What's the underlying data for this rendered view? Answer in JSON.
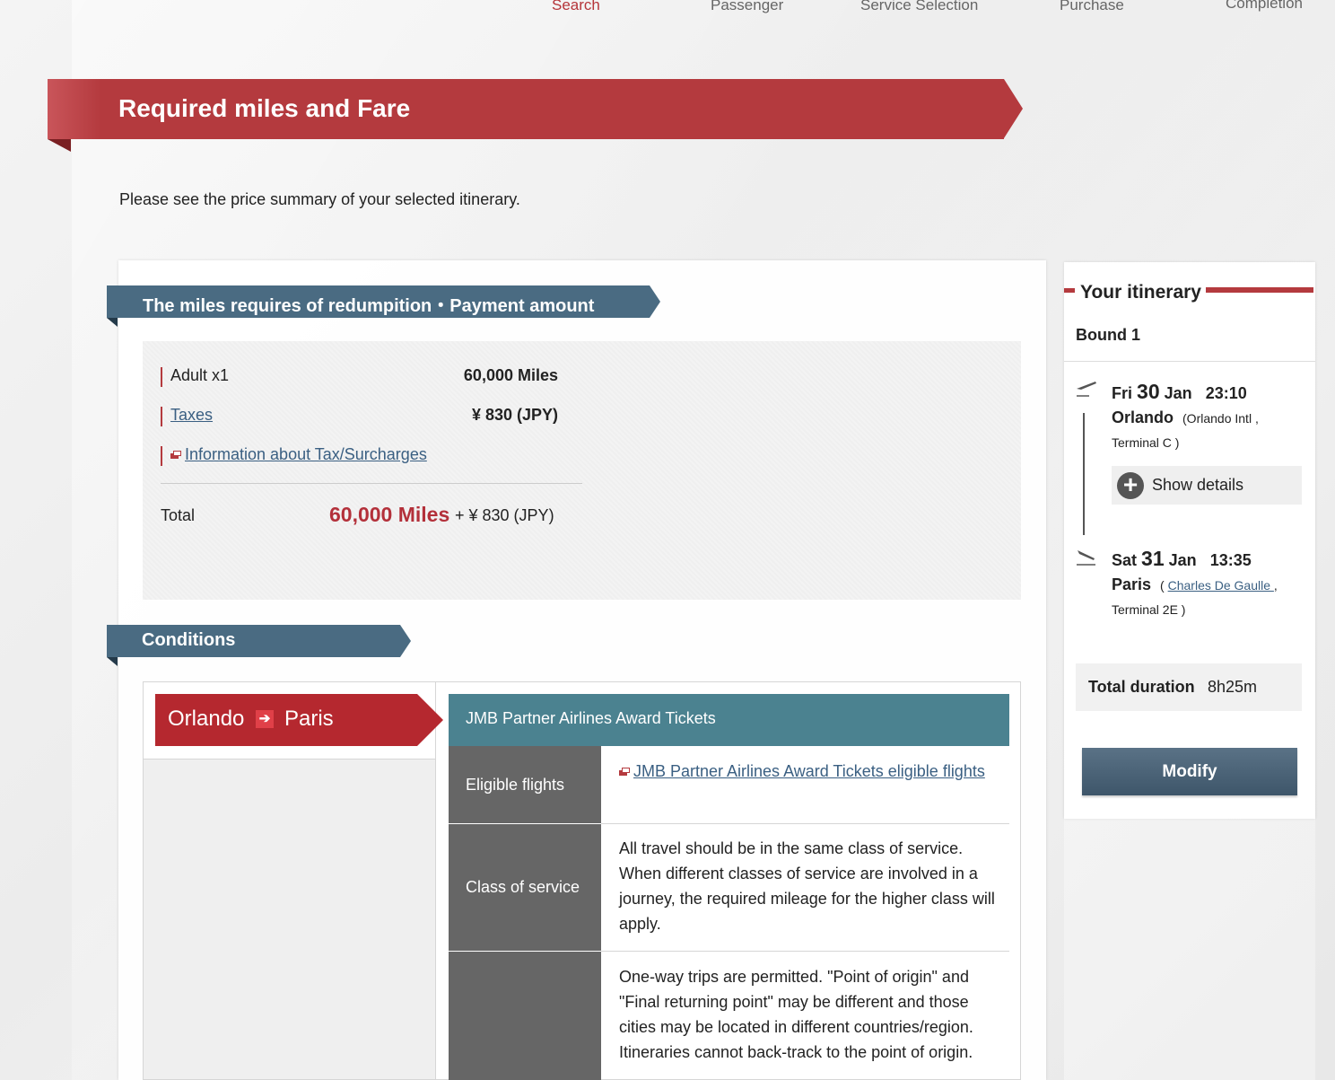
{
  "steps": [
    "Search",
    "Passenger",
    "Service Selection",
    "Purchase",
    "Completion"
  ],
  "title": "Required miles and Fare",
  "intro": "Please see the price summary of your selected itinerary.",
  "fare": {
    "section_title": "The miles requires of redumpition・Payment amount",
    "adult_label": "Adult x1",
    "adult_value": "60,000 Miles",
    "taxes_label": "Taxes",
    "taxes_value": "¥ 830 (JPY)",
    "info_link": "Information about Tax/Surcharges",
    "total_label": "Total",
    "total_miles": "60,000 Miles",
    "total_plus": "+ ¥ 830 (JPY)"
  },
  "conditions": {
    "section_title": "Conditions",
    "route_from": "Orlando",
    "route_arrow": "➔",
    "route_to": "Paris",
    "header": "JMB Partner Airlines Award Tickets",
    "rows": [
      {
        "label": "Eligible flights",
        "link": "JMB Partner Airlines Award Tickets eligible flights"
      },
      {
        "label": "Class of service",
        "text": "All travel should be in the same class of service. When different classes of service are involved in a journey, the required mileage for the higher class will apply."
      },
      {
        "label": "",
        "text": "One-way trips are permitted. \"Point of origin\" and \"Final returning point\" may be different and those cities may be located in different countries/region. Itineraries cannot back-track to the point of origin."
      }
    ]
  },
  "itinerary": {
    "title": "Your itinerary",
    "bound": "Bound 1",
    "depart": {
      "weekday": "Fri",
      "day": "30",
      "month": "Jan",
      "time": "23:10",
      "city": "Orlando",
      "airport": "(Orlando Intl ,",
      "terminal": "Terminal C )"
    },
    "show_details": "Show details",
    "arrive": {
      "weekday": "Sat",
      "day": "31",
      "month": "Jan",
      "time": "13:35",
      "city": "Paris",
      "airport_open": "(",
      "airport": "Charles De Gaulle ",
      "airport_close": ",",
      "terminal": "Terminal 2E )"
    },
    "duration_label": "Total duration",
    "duration_value": "8h25m",
    "modify": "Modify"
  }
}
